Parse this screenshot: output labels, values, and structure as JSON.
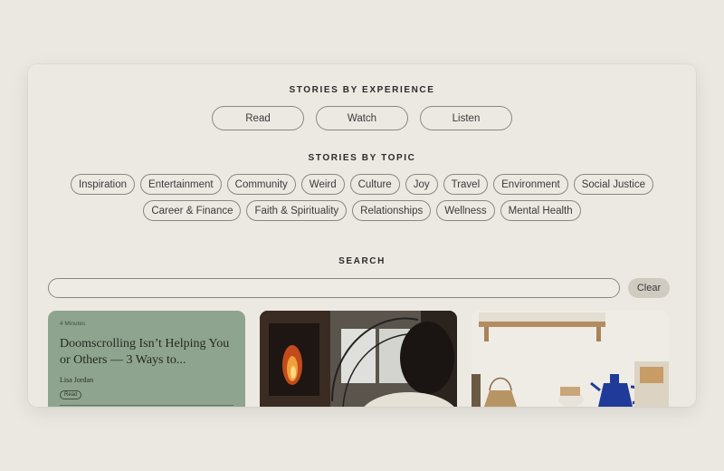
{
  "experience": {
    "title": "STORIES BY EXPERIENCE",
    "options": [
      "Read",
      "Watch",
      "Listen"
    ]
  },
  "topics": {
    "title": "STORIES BY TOPIC",
    "row1": [
      "Inspiration",
      "Entertainment",
      "Community",
      "Weird",
      "Culture",
      "Joy",
      "Travel",
      "Environment",
      "Social Justice"
    ],
    "row2": [
      "Career & Finance",
      "Faith & Spirituality",
      "Relationships",
      "Wellness",
      "Mental Health"
    ]
  },
  "search": {
    "title": "SEARCH",
    "value": "",
    "clear_label": "Clear"
  },
  "cards": [
    {
      "duration": "4 Minutes",
      "title": "Doomscrolling Isn’t Helping You or Others — 3 Ways to...",
      "author": "Lisa Jordan",
      "tag": "Read"
    }
  ],
  "colors": {
    "page_bg": "#ebe8e1",
    "panel_bg": "#ece9e2",
    "card_green": "#8fa48e",
    "clear_button_bg": "#cfcbc1"
  }
}
